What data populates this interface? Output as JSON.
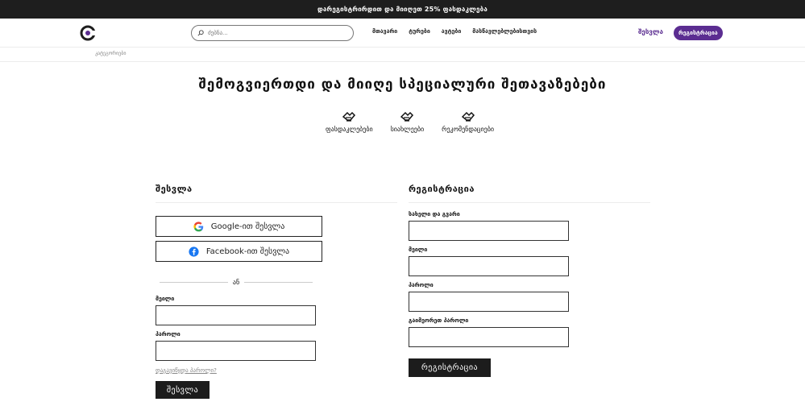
{
  "promo": {
    "text": "დარეგისტრირდით და მიიღეთ 25% ფასდაკლება"
  },
  "header": {
    "search_placeholder": "ძებნა...",
    "nav": [
      "მთავარი",
      "ტურები",
      "ავტები",
      "მასწავლებლებისთვის"
    ],
    "signin_label": "შესვლა",
    "register_label": "რეგისტრაცია"
  },
  "breadcrumb": {
    "label": "კატეგორიები"
  },
  "hero": {
    "title": "შემოგვიერთდი და მიიღე სპეციალური შეთავაზებები",
    "perks": [
      "ფასდაკლებები",
      "სიახლეები",
      "რეკომენდაციები"
    ]
  },
  "login": {
    "title": "შესვლა",
    "google_label": "Google-ით შესვლა",
    "facebook_label": "Facebook-ით შესვლა",
    "or_label": "ან",
    "email_label": "მეილი",
    "password_label": "პაროლი",
    "forgot_label": "დაგავიწყდა პაროლი?",
    "submit_label": "შესვლა"
  },
  "register": {
    "title": "რეგისტრაცია",
    "name_label": "სახელი და გვარი",
    "email_label": "მეილი",
    "password_label": "პაროლი",
    "repeat_password_label": "გაიმეორეთ პაროლი",
    "submit_label": "რეგისტრაცია"
  },
  "colors": {
    "accent": "#5b2d91",
    "dark": "#1c1c1c"
  }
}
